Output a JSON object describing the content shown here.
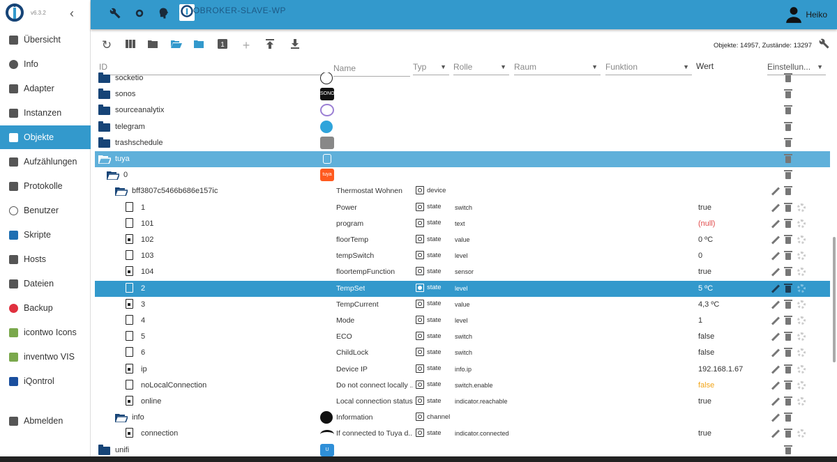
{
  "app": {
    "version": "v6.3.2",
    "host": "IOBROKER-SLAVE-WP",
    "user": "Heiko"
  },
  "sidebar": {
    "items": [
      {
        "label": "Übersicht",
        "icon": "grid-icon",
        "color": "#555"
      },
      {
        "label": "Info",
        "icon": "info-icon",
        "color": "#555"
      },
      {
        "label": "Adapter",
        "icon": "store-icon",
        "color": "#555"
      },
      {
        "label": "Instanzen",
        "icon": "instances-icon",
        "color": "#555"
      },
      {
        "label": "Objekte",
        "icon": "list-icon",
        "color": "#fff",
        "active": true
      },
      {
        "label": "Aufzählungen",
        "icon": "enum-icon",
        "color": "#555"
      },
      {
        "label": "Protokolle",
        "icon": "log-icon",
        "color": "#555"
      },
      {
        "label": "Benutzer",
        "icon": "user-icon",
        "color": "#555"
      },
      {
        "label": "Skripte",
        "icon": "script-icon",
        "color": "#1f6fb2"
      },
      {
        "label": "Hosts",
        "icon": "hosts-icon",
        "color": "#555"
      },
      {
        "label": "Dateien",
        "icon": "files-icon",
        "color": "#555"
      },
      {
        "label": "Backup",
        "icon": "backup-icon",
        "color": "#e0303e"
      },
      {
        "label": "icontwo Icons",
        "icon": "icontwo-icon",
        "color": "#7aa84c"
      },
      {
        "label": "inventwo VIS",
        "icon": "inventwo-icon",
        "color": "#7aa84c"
      },
      {
        "label": "iQontrol",
        "icon": "iqontrol-icon",
        "color": "#1a4f9e"
      },
      {
        "label": "Abmelden",
        "icon": "logout-icon",
        "color": "#555"
      }
    ]
  },
  "toolbar": {
    "counts": "Objekte: 14957, Zustände: 13297",
    "add": "+"
  },
  "header": {
    "id": "ID",
    "name": "Name",
    "typ": "Typ",
    "rolle": "Rolle",
    "raum": "Raum",
    "funktion": "Funktion",
    "wert": "Wert",
    "settings": "Einstellun..."
  },
  "rows": [
    {
      "id": "socketio",
      "kind": "folder",
      "indent": 0,
      "obj": "socketio-icon",
      "objColor": "#222",
      "acts": "t"
    },
    {
      "id": "sonos",
      "kind": "folder",
      "indent": 0,
      "obj": "sonos-icon",
      "objColor": "#111",
      "objText": "SONOS",
      "acts": "t"
    },
    {
      "id": "sourceanalytix",
      "kind": "folder",
      "indent": 0,
      "obj": "sourceanalytix-icon",
      "objColor": "#9b7fd4",
      "acts": "t"
    },
    {
      "id": "telegram",
      "kind": "folder",
      "indent": 0,
      "obj": "telegram-icon",
      "objColor": "#2fa4db",
      "acts": "t"
    },
    {
      "id": "trashschedule",
      "kind": "folder",
      "indent": 0,
      "obj": "trashschedule-icon",
      "objColor": "#888",
      "acts": "t"
    },
    {
      "id": "tuya",
      "kind": "folder-open",
      "indent": 0,
      "obj": "copy-icon",
      "objColor": "#fff",
      "acts": "t",
      "sel": "sel1"
    },
    {
      "id": "0",
      "kind": "folder-open",
      "indent": 1,
      "obj": "tuya-icon",
      "objColor": "#ff5a1f",
      "objText": "tuya",
      "acts": "t"
    },
    {
      "id": "bff3807c5466b686e157ic",
      "kind": "folder-open",
      "indent": 2,
      "name": "Thermostat Wohnen",
      "typ": "device",
      "typIcon": "device-icon",
      "acts": "pt"
    },
    {
      "id": "1",
      "kind": "file",
      "indent": 3,
      "name": "Power",
      "typ": "state",
      "role": "switch",
      "val": "true",
      "acts": "ptg"
    },
    {
      "id": "101",
      "kind": "file",
      "indent": 3,
      "name": "program",
      "typ": "state",
      "role": "text",
      "val": "(null)",
      "valClass": "null",
      "acts": "ptg"
    },
    {
      "id": "102",
      "kind": "file lock",
      "indent": 3,
      "name": "floorTemp",
      "typ": "state",
      "role": "value",
      "val": "0 ºC",
      "acts": "ptg"
    },
    {
      "id": "103",
      "kind": "file",
      "indent": 3,
      "name": "tempSwitch",
      "typ": "state",
      "role": "level",
      "val": "0",
      "acts": "ptg"
    },
    {
      "id": "104",
      "kind": "file lock",
      "indent": 3,
      "name": "floortempFunction",
      "typ": "state",
      "role": "sensor",
      "val": "true",
      "acts": "ptg"
    },
    {
      "id": "2",
      "kind": "file",
      "indent": 3,
      "name": "TempSet",
      "typ": "state",
      "role": "level",
      "val": "5 ºC",
      "acts": "ptg",
      "sel": "sel2"
    },
    {
      "id": "3",
      "kind": "file lock",
      "indent": 3,
      "name": "TempCurrent",
      "typ": "state",
      "role": "value",
      "val": "4,3 ºC",
      "acts": "ptg"
    },
    {
      "id": "4",
      "kind": "file",
      "indent": 3,
      "name": "Mode",
      "typ": "state",
      "role": "level",
      "val": "1",
      "acts": "ptg"
    },
    {
      "id": "5",
      "kind": "file",
      "indent": 3,
      "name": "ECO",
      "typ": "state",
      "role": "switch",
      "val": "false",
      "acts": "ptg"
    },
    {
      "id": "6",
      "kind": "file",
      "indent": 3,
      "name": "ChildLock",
      "typ": "state",
      "role": "switch",
      "val": "false",
      "acts": "ptg"
    },
    {
      "id": "ip",
      "kind": "file lock",
      "indent": 3,
      "name": "Device IP",
      "typ": "state",
      "role": "info.ip",
      "val": "192.168.1.67",
      "acts": "ptg"
    },
    {
      "id": "noLocalConnection",
      "kind": "file",
      "indent": 3,
      "name": "Do not connect locally ...",
      "typ": "state",
      "role": "switch.enable",
      "val": "false",
      "valClass": "orange",
      "acts": "ptg"
    },
    {
      "id": "online",
      "kind": "file lock",
      "indent": 3,
      "name": "Local connection status",
      "typ": "state",
      "role": "indicator.reachable",
      "val": "true",
      "acts": "ptg"
    },
    {
      "id": "info",
      "kind": "folder-open",
      "indent": 2,
      "name": "Information",
      "typ": "channel",
      "typIcon": "channel-icon",
      "obj": "info-icon",
      "objColor": "#111",
      "acts": "pt"
    },
    {
      "id": "connection",
      "kind": "file lock",
      "indent": 3,
      "name": "If connected to Tuya d...",
      "typ": "state",
      "role": "indicator.connected",
      "val": "true",
      "obj": "wifi-icon",
      "objColor": "#111",
      "acts": "ptg"
    },
    {
      "id": "unifi",
      "kind": "folder",
      "indent": 0,
      "obj": "unifi-icon",
      "objColor": "#2f8fd8",
      "objText": "U",
      "acts": "t"
    }
  ]
}
